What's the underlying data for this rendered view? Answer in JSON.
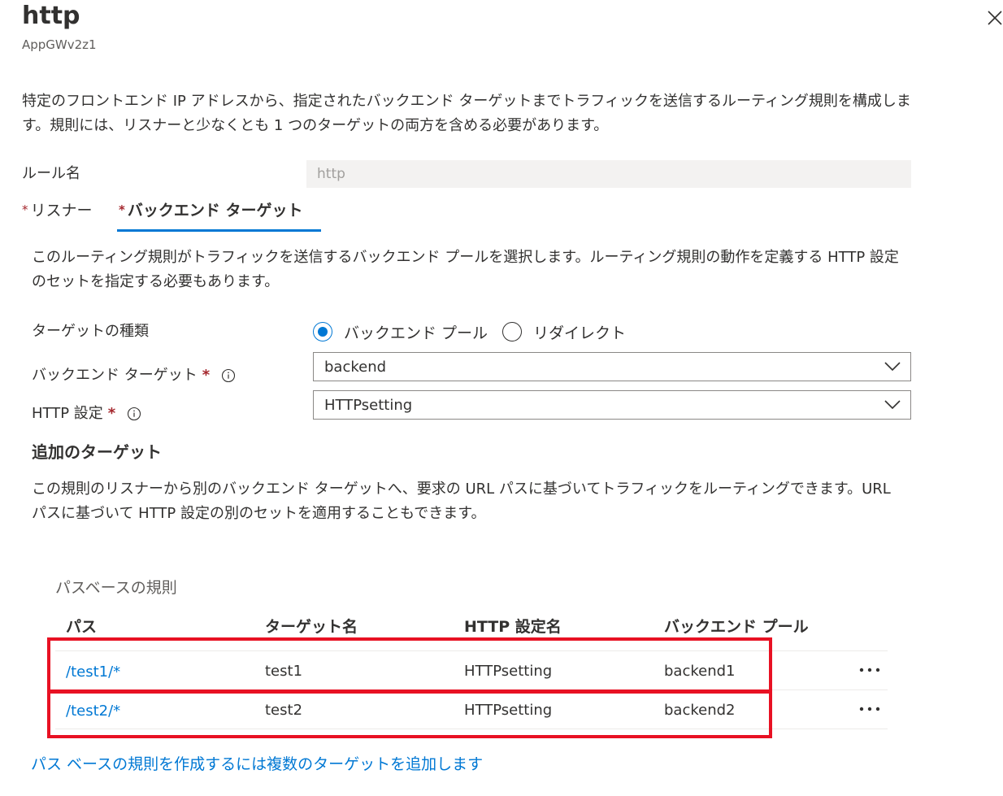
{
  "header": {
    "title": "http",
    "subtitle": "AppGWv2z1"
  },
  "description": "特定のフロントエンド IP アドレスから、指定されたバックエンド ターゲットまでトラフィックを送信するルーティング規則を構成します。規則には、リスナーと少なくとも 1 つのターゲットの両方を含める必要があります。",
  "rule_name": {
    "label": "ルール名",
    "value": "http"
  },
  "tabs": [
    {
      "label": "リスナー",
      "required": "*",
      "active": false
    },
    {
      "label": "バックエンド ターゲット",
      "required": "*",
      "active": true
    }
  ],
  "backend_panel": {
    "description": "このルーティング規則がトラフィックを送信するバックエンド プールを選択します。ルーティング規則の動作を定義する HTTP 設定のセットを指定する必要もあります。",
    "target_type": {
      "label": "ターゲットの種類",
      "options": [
        "バックエンド プール",
        "リダイレクト"
      ],
      "selected": "バックエンド プール"
    },
    "backend_target": {
      "label": "バックエンド ターゲット",
      "required": "*",
      "value": "backend"
    },
    "http_setting": {
      "label": "HTTP 設定",
      "required": "*",
      "value": "HTTPsetting"
    }
  },
  "additional_targets": {
    "title": "追加のターゲット",
    "description": "この規則のリスナーから別のバックエンド ターゲットへ、要求の URL パスに基づいてトラフィックをルーティングできます。URL パスに基づいて HTTP 設定の別のセットを適用することもできます。"
  },
  "path_rules": {
    "caption": "パスベースの規則",
    "columns": [
      "パス",
      "ターゲット名",
      "HTTP 設定名",
      "バックエンド プール"
    ],
    "rows": [
      {
        "path": "/test1/*",
        "target": "test1",
        "setting": "HTTPsetting",
        "pool": "backend1"
      },
      {
        "path": "/test2/*",
        "target": "test2",
        "setting": "HTTPsetting",
        "pool": "backend2"
      }
    ]
  },
  "footer_link": "パス ベースの規則を作成するには複数のターゲットを追加します",
  "colors": {
    "accent": "#0078d4",
    "required": "#a4262c",
    "highlight": "#e81123"
  }
}
